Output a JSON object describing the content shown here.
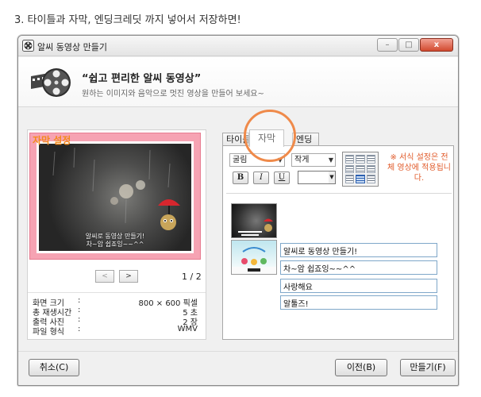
{
  "caption": "3. 타이틀과 자막, 엔딩크레딧 까지 넣어서 저장하면!",
  "window": {
    "title": "알씨 동영상 만들기",
    "controls": {
      "minimize": "–",
      "maximize": "□",
      "close": "x"
    }
  },
  "header": {
    "title": "“쉽고 편리한 알씨 동영상”",
    "subtitle": "원하는 이미지와 음악으로 멋진 영상을 만들어 보세요~"
  },
  "preview": {
    "overlay_label": "자막 설정",
    "caption_line1": "알씨로 동영상 만들기!",
    "caption_line2": "차~암 쉽죠잉~~^^",
    "prev_label": "<",
    "next_label": ">",
    "page_indicator": "1 / 2"
  },
  "info": [
    {
      "label": "화면 크기",
      "value": "800 × 600 픽셀"
    },
    {
      "label": "총 재생시간",
      "value": "5 초"
    },
    {
      "label": "출력 사진",
      "value": "2 장"
    },
    {
      "label": "파일 형식",
      "value": "WMV"
    }
  ],
  "info_separator": ":",
  "tabs": [
    {
      "label": "타이틀"
    },
    {
      "label": "자막",
      "active": true
    },
    {
      "label": "엔딩"
    }
  ],
  "format": {
    "font": "굴림",
    "size": "작게",
    "bold": "B",
    "italic": "I",
    "underline": "U",
    "text_color": "#ffffff",
    "note": "※ 서식 설정은 전체 영상에 적용됩니다."
  },
  "subtitles": [
    "알씨로 동영상 만들기!",
    "차~암 쉽죠잉~~^^",
    "사랑해요",
    "알툴즈!"
  ],
  "buttons": {
    "cancel": "취소(C)",
    "prev": "이전(B)",
    "make": "만들기(F)"
  },
  "colors": {
    "accent_orange": "#ef8a4a",
    "note_red": "#e15b2b",
    "frame_pink": "#f6a3b3"
  }
}
